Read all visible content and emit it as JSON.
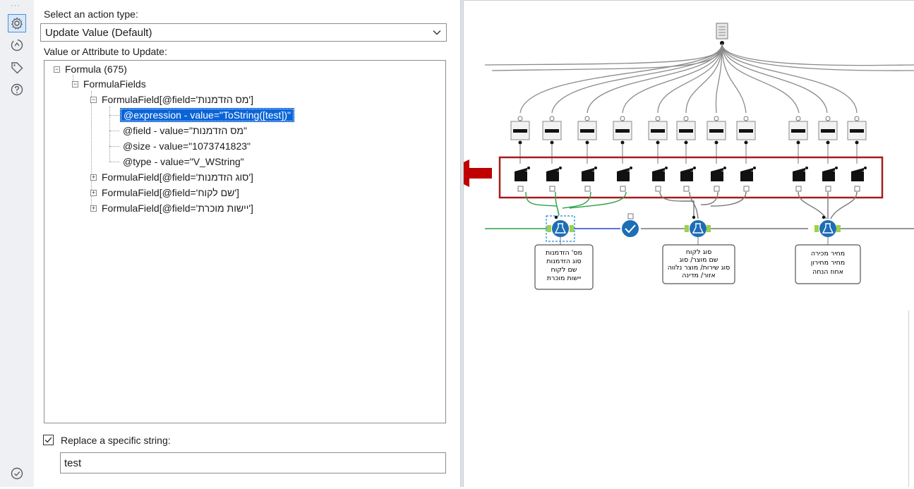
{
  "toolbar": {
    "grip": "···",
    "icons": [
      "gear-icon",
      "navigate-icon",
      "tag-icon",
      "help-icon",
      "check-circle-icon"
    ]
  },
  "config": {
    "action_label": "Select an action type:",
    "action_value": "Update Value (Default)",
    "value_label": "Value or Attribute to Update:",
    "tree": {
      "root": "Formula (675)",
      "fields_node": "FormulaFields",
      "field1": "FormulaField[@field='מס הזדמנות']",
      "expression": "@expression - value=\"ToString([test])\"",
      "field_attr": "@field - value=\"מס הזדמנות\"",
      "size_attr": "@size - value=\"1073741823\"",
      "type_attr": "@type - value=\"V_WString\"",
      "field2": "FormulaField[@field='סוג הזדמנות']",
      "field3": "FormulaField[@field='שם לקוח']",
      "field4": "FormulaField[@field='יישות מוכרת']"
    },
    "replace_label": "Replace a specific string:",
    "replace_checked": true,
    "replace_value": "test"
  },
  "canvas": {
    "annotation1": [
      "מס' הזדמנות",
      "סוג הזדמנות",
      "שם לקוח",
      "יישות מוכרת"
    ],
    "annotation2": [
      "סוג לקוח",
      "שם מוצר/ סוג",
      "סוג שירות/ מוצר נלווה",
      "אזור/ מדינה"
    ],
    "annotation3": [
      "מחיר מכירה",
      "מחיר מחירון",
      "אחוז הנחה"
    ],
    "colors": {
      "highlight_box": "#a31d1d",
      "arrow": "#c00000",
      "tool_blue": "#1e6db7",
      "connector_green": "#2aa14b",
      "connector_blue": "#2a3fd4"
    }
  }
}
